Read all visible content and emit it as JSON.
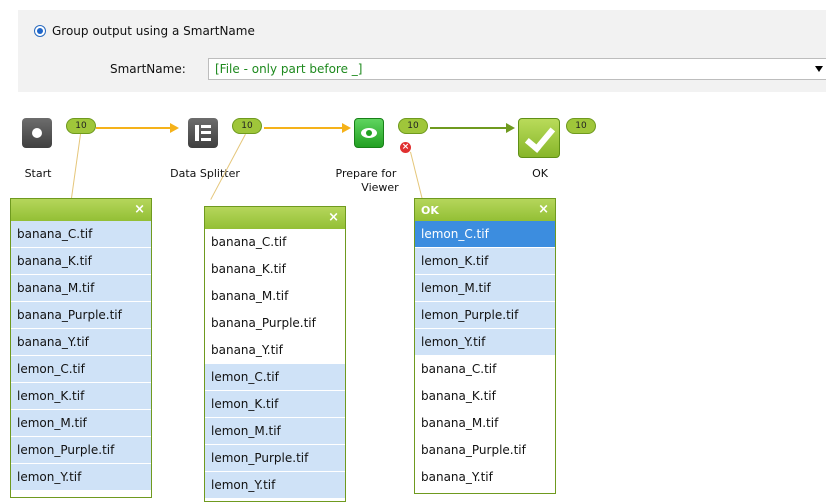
{
  "options": {
    "radio_label": "Group output using a SmartName",
    "smartname_label": "SmartName:",
    "smartname_value": "[File - only part before _]"
  },
  "flow": {
    "nodes": [
      {
        "label": "Start",
        "count": "10"
      },
      {
        "label": "Data Splitter",
        "count": "10"
      },
      {
        "label_line1": "Prepare for",
        "label_line2": "Viewer",
        "count": "10"
      },
      {
        "label": "OK",
        "count": "10"
      }
    ],
    "colors": {
      "connector_orange": "#f5b21a",
      "connector_green": "#6f9a1f",
      "badge": "#9fc63a",
      "accent_blue": "#3c8ddf"
    }
  },
  "panels": [
    {
      "title": "",
      "items": [
        "banana_C.tif",
        "banana_K.tif",
        "banana_M.tif",
        "banana_Purple.tif",
        "banana_Y.tif",
        "lemon_C.tif",
        "lemon_K.tif",
        "lemon_M.tif",
        "lemon_Purple.tif",
        "lemon_Y.tif"
      ]
    },
    {
      "title": "",
      "items": [
        "banana_C.tif",
        "banana_K.tif",
        "banana_M.tif",
        "banana_Purple.tif",
        "banana_Y.tif",
        "lemon_C.tif",
        "lemon_K.tif",
        "lemon_M.tif",
        "lemon_Purple.tif",
        "lemon_Y.tif"
      ]
    },
    {
      "title": "OK",
      "items": [
        "lemon_C.tif",
        "lemon_K.tif",
        "lemon_M.tif",
        "lemon_Purple.tif",
        "lemon_Y.tif",
        "banana_C.tif",
        "banana_K.tif",
        "banana_M.tif",
        "banana_Purple.tif",
        "banana_Y.tif"
      ]
    }
  ]
}
